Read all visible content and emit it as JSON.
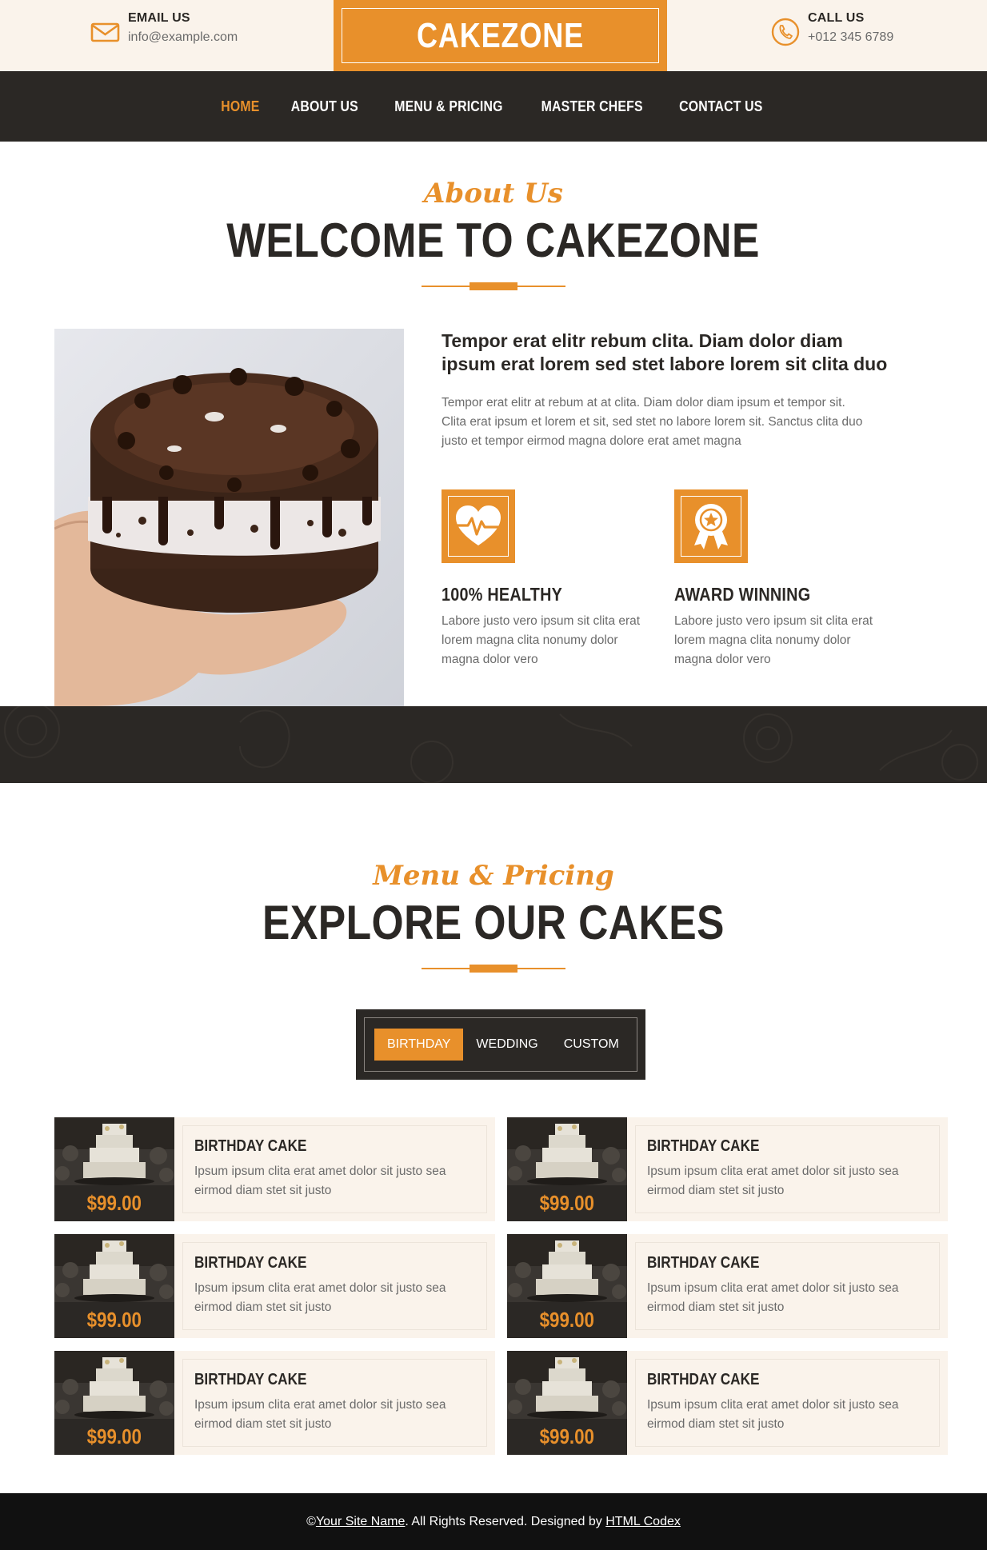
{
  "colors": {
    "accent": "#e8902b",
    "dark": "#2b2825",
    "cream": "#faf3eb",
    "footer": "#111111"
  },
  "topbar": {
    "email": {
      "icon": "envelope-icon",
      "label": "EMAIL US",
      "value": "info@example.com"
    },
    "brand": "CAKEZONE",
    "phone": {
      "icon": "phone-icon",
      "label": "CALL US",
      "value": "+012 345 6789"
    }
  },
  "nav": {
    "items": [
      {
        "label": "HOME",
        "active": true
      },
      {
        "label": "ABOUT US"
      },
      {
        "label": "MENU & PRICING"
      },
      {
        "label": "MASTER CHEFS"
      },
      {
        "label": "CONTACT US"
      }
    ]
  },
  "about": {
    "script": "About Us",
    "title": "WELCOME TO CAKEZONE",
    "heading": "Tempor erat elitr rebum clita. Diam dolor diam ipsum erat lorem sed stet labore lorem sit clita duo",
    "text": "Tempor erat elitr at rebum at at clita. Diam dolor diam ipsum et tempor sit. Clita erat ipsum et lorem et sit, sed stet no labore lorem sit. Sanctus clita duo justo et tempor eirmod magna dolore erat amet magna",
    "features": [
      {
        "icon": "heartbeat-icon",
        "title": "100% HEALTHY",
        "text": "Labore justo vero ipsum sit clita erat lorem magna clita nonumy dolor magna dolor vero"
      },
      {
        "icon": "award-icon",
        "title": "AWARD WINNING",
        "text": "Labore justo vero ipsum sit clita erat lorem magna clita nonumy dolor magna dolor vero"
      }
    ]
  },
  "menu": {
    "script": "Menu & Pricing",
    "title": "EXPLORE OUR CAKES",
    "tabs": [
      {
        "label": "BIRTHDAY",
        "active": true
      },
      {
        "label": "WEDDING"
      },
      {
        "label": "CUSTOM"
      }
    ],
    "items": [
      {
        "title": "BIRTHDAY CAKE",
        "text": "Ipsum ipsum clita erat amet dolor sit justo sea eirmod diam stet sit justo",
        "price": "$99.00"
      },
      {
        "title": "BIRTHDAY CAKE",
        "text": "Ipsum ipsum clita erat amet dolor sit justo sea eirmod diam stet sit justo",
        "price": "$99.00"
      },
      {
        "title": "BIRTHDAY CAKE",
        "text": "Ipsum ipsum clita erat amet dolor sit justo sea eirmod diam stet sit justo",
        "price": "$99.00"
      },
      {
        "title": "BIRTHDAY CAKE",
        "text": "Ipsum ipsum clita erat amet dolor sit justo sea eirmod diam stet sit justo",
        "price": "$99.00"
      },
      {
        "title": "BIRTHDAY CAKE",
        "text": "Ipsum ipsum clita erat amet dolor sit justo sea eirmod diam stet sit justo",
        "price": "$99.00"
      },
      {
        "title": "BIRTHDAY CAKE",
        "text": "Ipsum ipsum clita erat amet dolor sit justo sea eirmod diam stet sit justo",
        "price": "$99.00"
      }
    ]
  },
  "footer": {
    "prefix": "© ",
    "site_link": "Your Site Name",
    "middle": ". All Rights Reserved. Designed by ",
    "designer_link": "HTML Codex"
  }
}
